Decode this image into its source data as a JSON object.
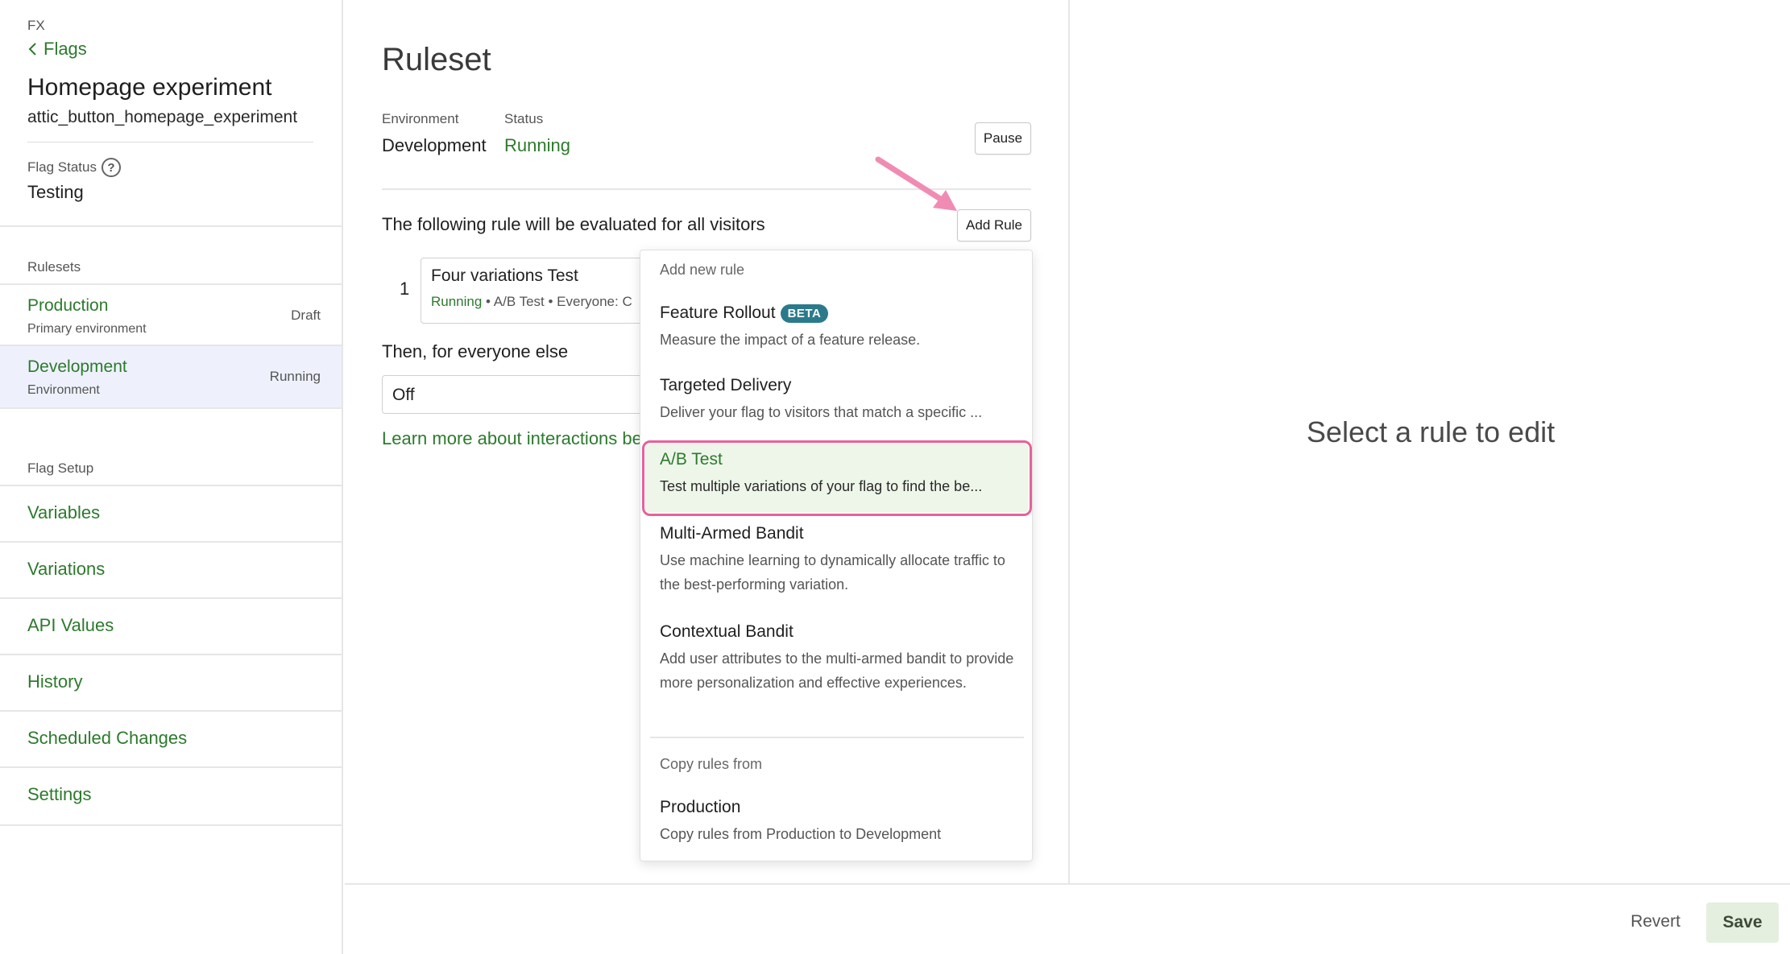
{
  "sidebar": {
    "app_label": "FX",
    "back_label": "Flags",
    "flag_name": "Homepage experiment",
    "flag_key": "attic_button_homepage_experiment",
    "flag_status_label": "Flag Status",
    "flag_status_value": "Testing",
    "rulesets_label": "Rulesets",
    "rulesets": [
      {
        "name": "Production",
        "sub": "Primary environment",
        "state": "Draft"
      },
      {
        "name": "Development",
        "sub": "Environment",
        "state": "Running"
      }
    ],
    "flag_setup_label": "Flag Setup",
    "setup_items": [
      "Variables",
      "Variations",
      "API Values",
      "History",
      "Scheduled Changes",
      "Settings"
    ]
  },
  "main": {
    "title": "Ruleset",
    "environment_label": "Environment",
    "environment_value": "Development",
    "status_label": "Status",
    "status_value": "Running",
    "pause_label": "Pause",
    "eval_text": "The following rule will be evaluated for all visitors",
    "add_rule_label": "Add Rule",
    "rule": {
      "number": "1",
      "title": "Four variations Test",
      "status": "Running",
      "meta": " • A/B Test • Everyone: C"
    },
    "everyone_else": "Then, for everyone else",
    "off_value": "Off",
    "learn_link": "Learn more about interactions be"
  },
  "dropdown": {
    "add_header": "Add new rule",
    "items": [
      {
        "title": "Feature Rollout",
        "badge": "BETA",
        "desc": "Measure the impact of a feature release."
      },
      {
        "title": "Targeted Delivery",
        "desc": "Deliver your flag to visitors that match a specific ..."
      },
      {
        "title": "A/B Test",
        "desc": "Test multiple variations of your flag to find the be..."
      },
      {
        "title": "Multi-Armed Bandit",
        "desc": "Use machine learning to dynamically allocate traffic to the best-performing variation."
      },
      {
        "title": "Contextual Bandit",
        "desc": "Add user attributes to the multi-armed bandit to provide more personalization and effective experiences."
      }
    ],
    "copy_header": "Copy rules from",
    "copy_item": {
      "title": "Production",
      "desc": "Copy rules from Production to Development"
    }
  },
  "right_panel": {
    "placeholder": "Select a rule to edit"
  },
  "footer": {
    "revert_label": "Revert",
    "save_label": "Save"
  },
  "colors": {
    "accent_green": "#2d7a2d",
    "highlight_pink": "#e8609a",
    "beta_badge": "#2a7a8c",
    "active_row": "#eef1fb"
  },
  "icons": {
    "back": "chevron-left-icon",
    "help": "question-circle-icon",
    "annotation": "pink-arrow-icon"
  }
}
